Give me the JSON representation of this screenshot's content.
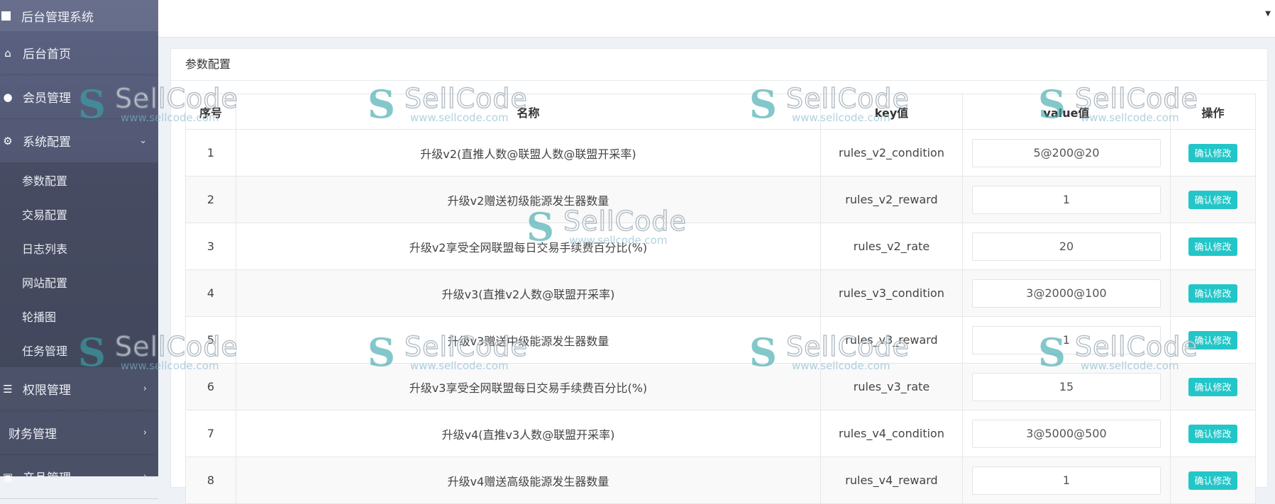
{
  "sidebar": {
    "brand": "后台管理系统",
    "items": [
      {
        "label": "后台首页",
        "icon": "home-icon"
      },
      {
        "label": "会员管理",
        "icon": "user-icon"
      },
      {
        "label": "系统配置",
        "icon": "cogs-icon"
      }
    ],
    "submenu": [
      "参数配置",
      "交易配置",
      "日志列表",
      "网站配置",
      "轮播图",
      "任务管理"
    ],
    "items_after": [
      {
        "label": "权限管理",
        "icon": "list-icon"
      },
      {
        "label": "财务管理"
      },
      {
        "label": "产品管理"
      }
    ]
  },
  "panel": {
    "title": "参数配置"
  },
  "table": {
    "headers": [
      "序号",
      "名称",
      "key值",
      "value值",
      "操作"
    ],
    "action_label": "确认修改",
    "rows": [
      {
        "id": "1",
        "name": "升级v2(直推人数@联盟人数@联盟开采率)",
        "key": "rules_v2_condition",
        "value": "5@200@20"
      },
      {
        "id": "2",
        "name": "升级v2赠送初级能源发生器数量",
        "key": "rules_v2_reward",
        "value": "1"
      },
      {
        "id": "3",
        "name": "升级v2享受全网联盟每日交易手续费百分比(%)",
        "key": "rules_v2_rate",
        "value": "20"
      },
      {
        "id": "4",
        "name": "升级v3(直推v2人数@联盟开采率)",
        "key": "rules_v3_condition",
        "value": "3@2000@100"
      },
      {
        "id": "5",
        "name": "升级v3赠送中级能源发生器数量",
        "key": "rules_v3_reward",
        "value": "1"
      },
      {
        "id": "6",
        "name": "升级v3享受全网联盟每日交易手续费百分比(%)",
        "key": "rules_v3_rate",
        "value": "15"
      },
      {
        "id": "7",
        "name": "升级v4(直推v3人数@联盟开采率)",
        "key": "rules_v4_condition",
        "value": "3@5000@500"
      },
      {
        "id": "8",
        "name": "升级v4赠送高级能源发生器数量",
        "key": "rules_v4_reward",
        "value": "1"
      }
    ]
  },
  "watermark": {
    "brand": "SellCode",
    "url": "www.sellcode.com"
  },
  "colors": {
    "sidebar": "#535a75",
    "accent_button": "#23c6c8"
  }
}
